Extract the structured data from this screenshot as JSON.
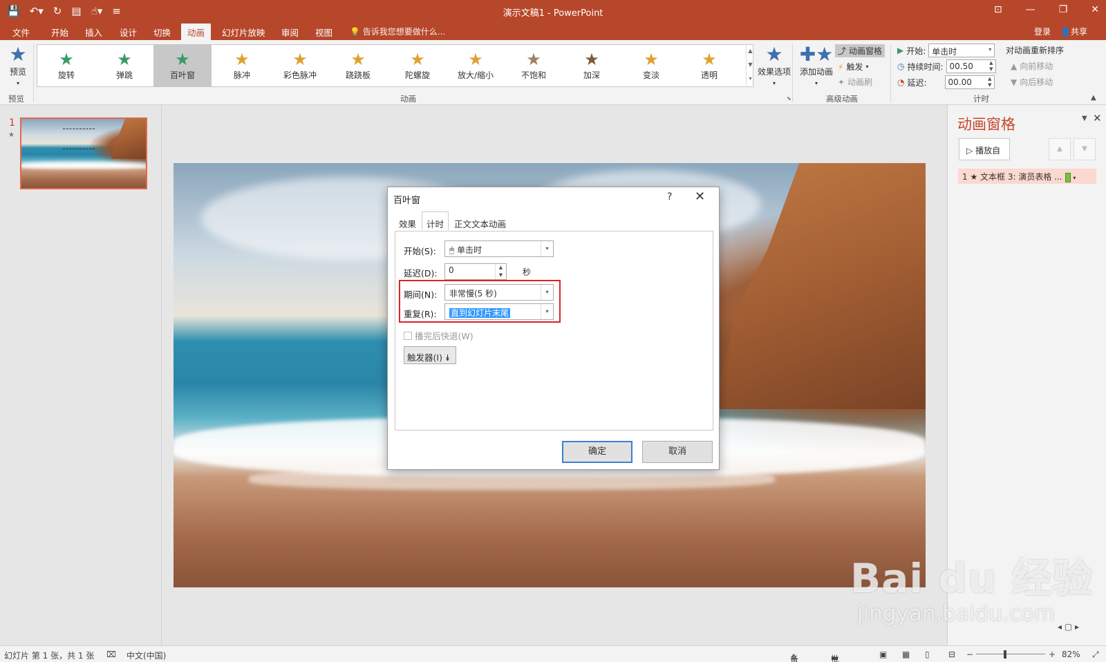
{
  "titlebar": {
    "title": "演示文稿1 - PowerPoint"
  },
  "menu": {
    "tabs": [
      "文件",
      "开始",
      "插入",
      "设计",
      "切换",
      "动画",
      "幻灯片放映",
      "审阅",
      "视图"
    ],
    "active_tab": "动画",
    "tell_me": "告诉我您想要做什么...",
    "login": "登录",
    "share": "共享"
  },
  "ribbon": {
    "preview_label": "预览",
    "preview_group": "预览",
    "animation_group": "动画",
    "animations": [
      {
        "label": "旋转",
        "color": "#3a9a6a"
      },
      {
        "label": "弹跳",
        "color": "#3a9a6a"
      },
      {
        "label": "百叶窗",
        "color": "#3a9a6a",
        "selected": true
      },
      {
        "label": "脉冲",
        "color": "#e0a030"
      },
      {
        "label": "彩色脉冲",
        "color": "#e0a030"
      },
      {
        "label": "跷跷板",
        "color": "#e0a030"
      },
      {
        "label": "陀螺旋",
        "color": "#e0a030"
      },
      {
        "label": "放大/缩小",
        "color": "#e0a030"
      },
      {
        "label": "不饱和",
        "color": "#a08060"
      },
      {
        "label": "加深",
        "color": "#7a5a3a"
      },
      {
        "label": "变淡",
        "color": "#e0a030"
      },
      {
        "label": "透明",
        "color": "#e0a030"
      }
    ],
    "effect_options": "效果选项",
    "add_animation": "添加动画",
    "animation_pane": "动画窗格",
    "trigger": "触发",
    "animation_painter": "动画刷",
    "advanced_group": "高级动画",
    "start_label": "开始:",
    "start_value": "单击时",
    "duration_label": "持续时间:",
    "duration_value": "00.50",
    "delay_label": "延迟:",
    "delay_value": "00.00",
    "reorder_label": "对动画重新排序",
    "move_earlier": "向前移动",
    "move_later": "向后移动",
    "timing_group": "计时"
  },
  "thumbs": {
    "number": "1"
  },
  "anim_pane": {
    "title": "动画窗格",
    "play_from": "播放自",
    "item": "1 ★ 文本框 3: 演员表格 ..."
  },
  "dialog": {
    "title": "百叶窗",
    "help": "?",
    "tabs": [
      "效果",
      "计时",
      "正文文本动画"
    ],
    "active_tab": "计时",
    "start_label": "开始(S):",
    "start_value": "单击时",
    "delay_label": "延迟(D):",
    "delay_value": "0",
    "delay_unit": "秒",
    "period_label": "期间(N):",
    "period_value": "非常慢(5 秒)",
    "repeat_label": "重复(R):",
    "repeat_value": "直到幻灯片末尾",
    "rewind_label": "播完后快退(W)",
    "trigger_label": "触发器(I)",
    "ok": "确定",
    "cancel": "取消"
  },
  "status": {
    "slide_info": "幻灯片 第 1 张，共 1 张",
    "language": "中文(中国)",
    "notes": "备注",
    "comments": "批注",
    "zoom": "82%"
  },
  "watermark": {
    "brand": "Bai du 经验",
    "url": "jingyan.baidu.com"
  },
  "colors": {
    "accent": "#b7472a",
    "selection": "#3399ff",
    "highlight_box": "#e02020"
  }
}
